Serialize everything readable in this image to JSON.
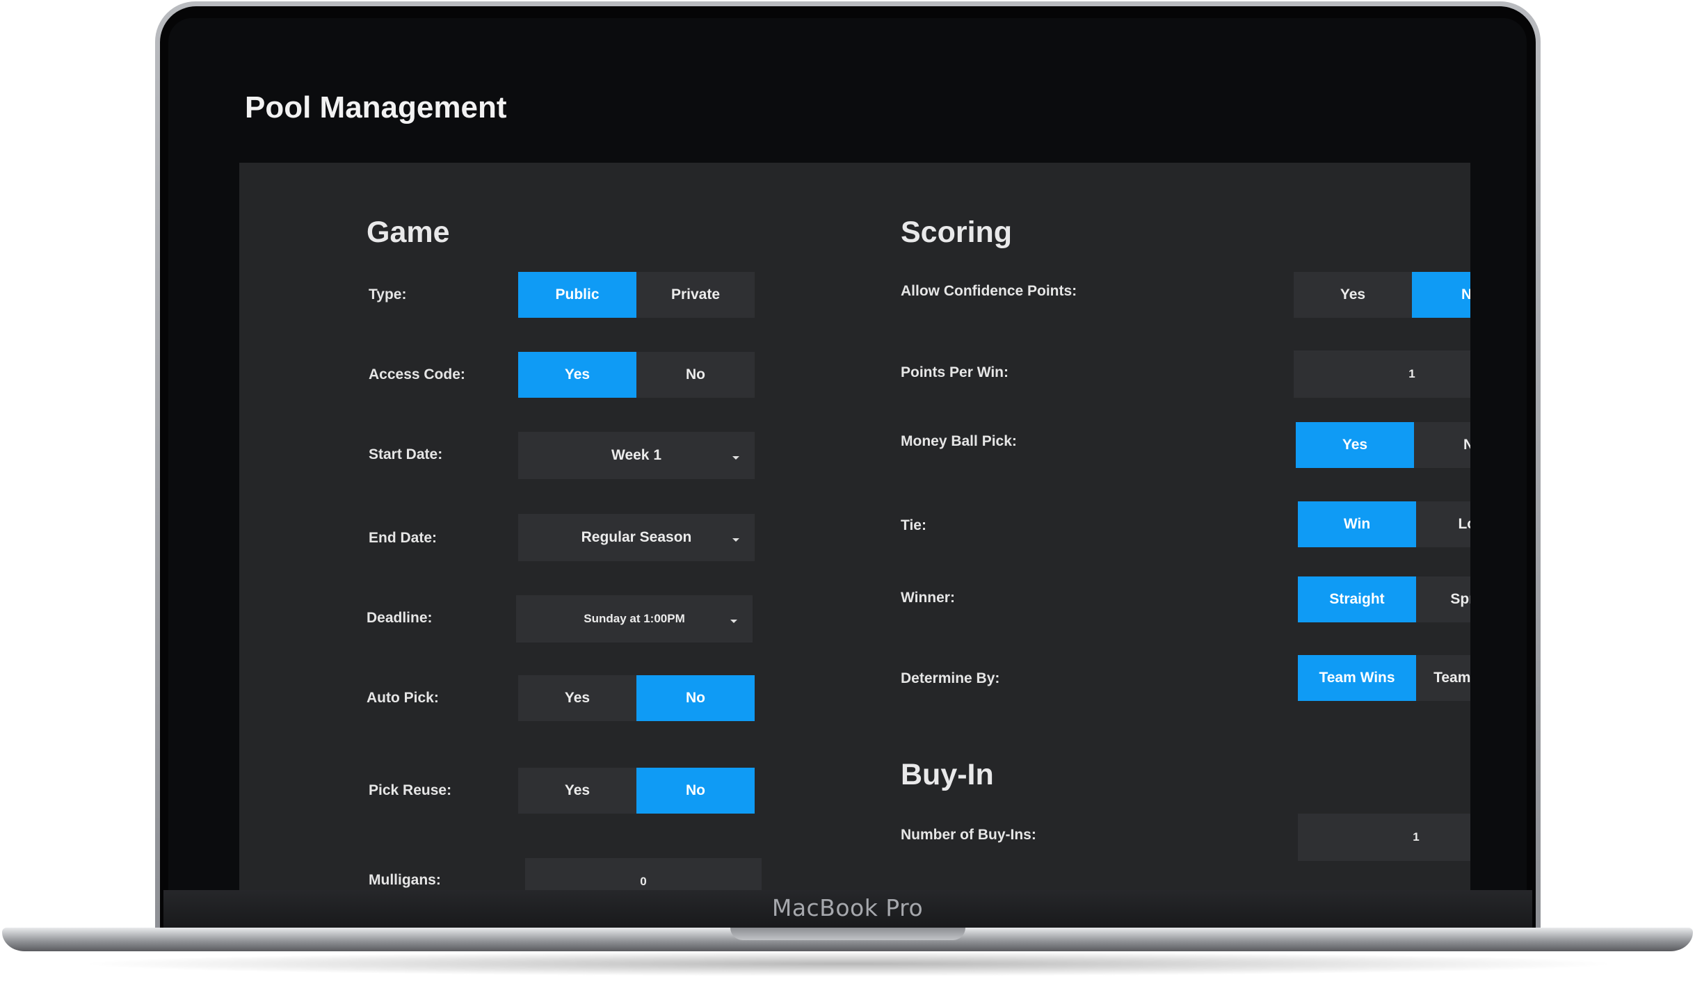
{
  "device": {
    "brand": "MacBook Pro"
  },
  "app": {
    "title": "Pool Management"
  },
  "game": {
    "title": "Game",
    "type": {
      "label": "Type:",
      "options": [
        "Public",
        "Private"
      ],
      "selected": "Public"
    },
    "access_code": {
      "label": "Access Code:",
      "options": [
        "Yes",
        "No"
      ],
      "selected": "Yes"
    },
    "start_date": {
      "label": "Start Date:",
      "value": "Week 1"
    },
    "end_date": {
      "label": "End Date:",
      "value": "Regular Season"
    },
    "deadline": {
      "label": "Deadline:",
      "value": "Sunday at 1:00PM"
    },
    "auto_pick": {
      "label": "Auto Pick:",
      "options": [
        "Yes",
        "No"
      ],
      "selected": "No"
    },
    "pick_reuse": {
      "label": "Pick Reuse:",
      "options": [
        "Yes",
        "No"
      ],
      "selected": "No"
    },
    "mulligans": {
      "label": "Mulligans:",
      "value": "0"
    }
  },
  "scoring": {
    "title": "Scoring",
    "allow_confidence": {
      "label": "Allow Confidence Points:",
      "options": [
        "Yes",
        "No"
      ],
      "selected": "No"
    },
    "points_per_win": {
      "label": "Points Per Win:",
      "value": "1"
    },
    "money_ball": {
      "label": "Money Ball Pick:",
      "options": [
        "Yes",
        "No"
      ],
      "selected": "Yes"
    },
    "tie": {
      "label": "Tie:",
      "options": [
        "Win",
        "Loss"
      ],
      "selected": "Win"
    },
    "winner": {
      "label": "Winner:",
      "options": [
        "Straight",
        "Spread"
      ],
      "selected": "Straight"
    },
    "determine_by": {
      "label": "Determine By:",
      "options": [
        "Team Wins",
        "Team Loses"
      ],
      "selected": "Team Wins"
    }
  },
  "buy_in": {
    "title": "Buy-In",
    "number_of_buy_ins": {
      "label": "Number of Buy-Ins:",
      "value": "1"
    }
  },
  "colors": {
    "accent": "#0f9bf5",
    "panel": "#252628",
    "control": "#2f3033",
    "screen": "#0b0c0e"
  }
}
